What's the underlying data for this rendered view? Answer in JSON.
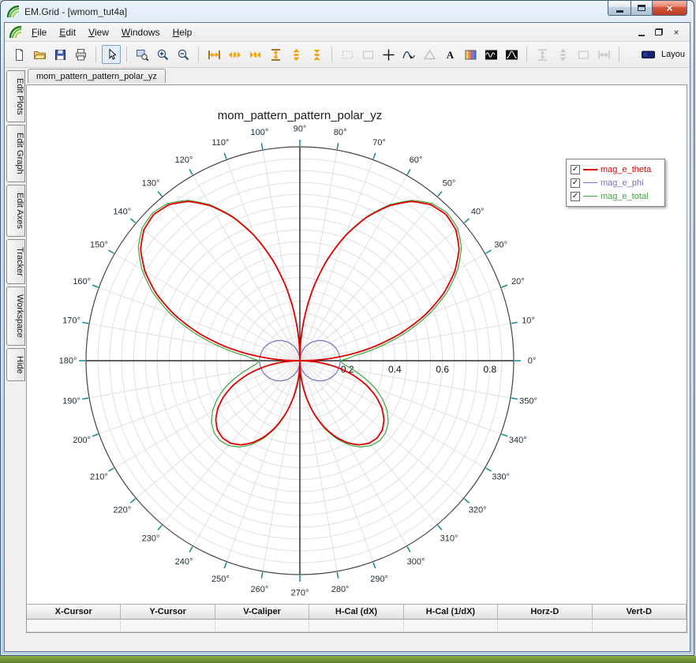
{
  "window": {
    "title": "EM.Grid - [wmom_tut4a]"
  },
  "menu": {
    "items": [
      "File",
      "Edit",
      "View",
      "Windows",
      "Help"
    ]
  },
  "toolbar": {
    "buttons": [
      {
        "name": "new-document-button",
        "icon": "doc-new"
      },
      {
        "name": "open-button",
        "icon": "folder-open"
      },
      {
        "name": "save-button",
        "icon": "save"
      },
      {
        "name": "print-button",
        "icon": "print"
      },
      {
        "sep": true
      },
      {
        "name": "pointer-tool-button",
        "icon": "pointer",
        "pressed": true
      },
      {
        "sep": true
      },
      {
        "name": "zoom-window-button",
        "icon": "zoom-window"
      },
      {
        "name": "zoom-in-button",
        "icon": "zoom-in"
      },
      {
        "name": "zoom-out-button",
        "icon": "zoom-out"
      },
      {
        "sep": true
      },
      {
        "name": "fit-width-button",
        "icon": "fit-width"
      },
      {
        "name": "expand-x-button",
        "icon": "arrows-out-h"
      },
      {
        "name": "collapse-x-button",
        "icon": "arrows-in-h"
      },
      {
        "name": "fit-height-button",
        "icon": "fit-height"
      },
      {
        "name": "expand-y-button",
        "icon": "arrows-out-v"
      },
      {
        "name": "collapse-y-button",
        "icon": "arrows-in-v"
      },
      {
        "sep": true
      },
      {
        "name": "zoom-box-button",
        "icon": "rect-dashed",
        "disabled": true
      },
      {
        "name": "select-region-button",
        "icon": "rect",
        "disabled": true
      },
      {
        "name": "crosshair-button",
        "icon": "crosshair"
      },
      {
        "name": "curve-tracker-button",
        "icon": "curve-tracker"
      },
      {
        "name": "marker-button",
        "icon": "triangle",
        "disabled": true
      },
      {
        "name": "text-annotation-button",
        "icon": "letter-a"
      },
      {
        "name": "colormap-button",
        "icon": "gradient"
      },
      {
        "name": "waveform-time-button",
        "icon": "wave1"
      },
      {
        "name": "waveform-pulse-button",
        "icon": "wave2"
      },
      {
        "sep": true
      },
      {
        "name": "fit-plot-vertical-button",
        "icon": "fit-v-gray",
        "disabled": true
      },
      {
        "name": "scale-vertical-button",
        "icon": "v-arrows-gray",
        "disabled": true
      },
      {
        "name": "blank-tool-button",
        "icon": "rect",
        "disabled": true
      },
      {
        "name": "fit-plot-horizontal-button",
        "icon": "h-arrows-gray",
        "disabled": true
      },
      {
        "sep": true
      },
      {
        "name": "layout-button",
        "icon": "layout",
        "label": "Layou",
        "right": true
      }
    ]
  },
  "side_tabs": [
    "Edit Plots",
    "Edit Graph",
    "Edit Axes",
    "Tracker",
    "Workspace",
    "Hide"
  ],
  "document_tab": {
    "label": "mom_pattern_pattern_polar_yz"
  },
  "chart_data": {
    "type": "polar-line",
    "title": "mom_pattern_pattern_polar_yz",
    "angle_unit": "deg",
    "angle_step_deg": 5,
    "r_max": 0.9,
    "r_ticks": [
      0.2,
      0.4,
      0.6,
      0.8
    ],
    "angle_ticks_deg": [
      0,
      10,
      20,
      30,
      40,
      50,
      60,
      70,
      80,
      90,
      100,
      110,
      120,
      130,
      140,
      150,
      160,
      170,
      180,
      190,
      200,
      210,
      220,
      230,
      240,
      250,
      260,
      270,
      280,
      290,
      300,
      310,
      320,
      330,
      340,
      350
    ],
    "grid": true,
    "legend_position": "top-right",
    "colors": {
      "tick": "#0e8c8c",
      "angle_label": "#1c2b33",
      "grid": "#e0e0e0",
      "axis": "#000000"
    },
    "series": [
      {
        "name": "mag_e_theta",
        "color": "#e00000",
        "width": 1.8,
        "checked": true,
        "values": [
          0.0,
          0.151,
          0.298,
          0.435,
          0.559,
          0.666,
          0.753,
          0.818,
          0.857,
          0.87,
          0.857,
          0.818,
          0.753,
          0.666,
          0.559,
          0.435,
          0.298,
          0.151,
          0.0,
          0.151,
          0.298,
          0.435,
          0.559,
          0.666,
          0.753,
          0.818,
          0.857,
          0.87,
          0.857,
          0.818,
          0.753,
          0.666,
          0.559,
          0.435,
          0.298,
          0.151,
          0.0,
          0.08,
          0.157,
          0.23,
          0.296,
          0.352,
          0.398,
          0.432,
          0.453,
          0.46,
          0.453,
          0.432,
          0.398,
          0.352,
          0.296,
          0.23,
          0.157,
          0.08,
          0.0,
          0.08,
          0.157,
          0.23,
          0.296,
          0.352,
          0.398,
          0.432,
          0.453,
          0.46,
          0.453,
          0.432,
          0.398,
          0.352,
          0.296,
          0.23,
          0.157,
          0.08,
          0.0
        ]
      },
      {
        "name": "mag_e_phi",
        "color": "#7272bf",
        "width": 1.2,
        "checked": true,
        "values": [
          0.17,
          0.169,
          0.167,
          0.164,
          0.16,
          0.154,
          0.147,
          0.139,
          0.13,
          0.12,
          0.109,
          0.098,
          0.085,
          0.072,
          0.058,
          0.044,
          0.03,
          0.015,
          0.0,
          0.015,
          0.03,
          0.044,
          0.058,
          0.072,
          0.085,
          0.098,
          0.109,
          0.12,
          0.13,
          0.139,
          0.147,
          0.154,
          0.16,
          0.164,
          0.167,
          0.169,
          0.17,
          0.169,
          0.167,
          0.164,
          0.16,
          0.154,
          0.147,
          0.139,
          0.13,
          0.12,
          0.109,
          0.098,
          0.085,
          0.072,
          0.058,
          0.044,
          0.03,
          0.015,
          0.0,
          0.015,
          0.03,
          0.044,
          0.058,
          0.072,
          0.085,
          0.098,
          0.109,
          0.12,
          0.13,
          0.139,
          0.147,
          0.154,
          0.16,
          0.164,
          0.167,
          0.169,
          0.17
        ]
      },
      {
        "name": "mag_e_total",
        "color": "#3da53d",
        "width": 1.2,
        "checked": true,
        "values": [
          0.17,
          0.227,
          0.342,
          0.465,
          0.581,
          0.684,
          0.767,
          0.83,
          0.867,
          0.878,
          0.864,
          0.824,
          0.758,
          0.67,
          0.562,
          0.437,
          0.3,
          0.152,
          0.0,
          0.152,
          0.3,
          0.437,
          0.562,
          0.67,
          0.758,
          0.824,
          0.864,
          0.878,
          0.867,
          0.83,
          0.767,
          0.684,
          0.581,
          0.465,
          0.342,
          0.227,
          0.17,
          0.187,
          0.229,
          0.282,
          0.336,
          0.384,
          0.424,
          0.454,
          0.471,
          0.475,
          0.466,
          0.443,
          0.407,
          0.359,
          0.302,
          0.234,
          0.16,
          0.081,
          0.0,
          0.081,
          0.16,
          0.234,
          0.302,
          0.359,
          0.407,
          0.443,
          0.466,
          0.475,
          0.471,
          0.454,
          0.424,
          0.384,
          0.336,
          0.282,
          0.229,
          0.187,
          0.17
        ]
      }
    ]
  },
  "cursor_table": {
    "headers": [
      "X-Cursor",
      "Y-Cursor",
      "V-Caliper",
      "H-Cal (dX)",
      "H-Cal (1/dX)",
      "Horz-D",
      "Vert-D"
    ],
    "rows": [
      [
        "",
        "",
        "",
        "",
        "",
        "",
        ""
      ]
    ]
  }
}
